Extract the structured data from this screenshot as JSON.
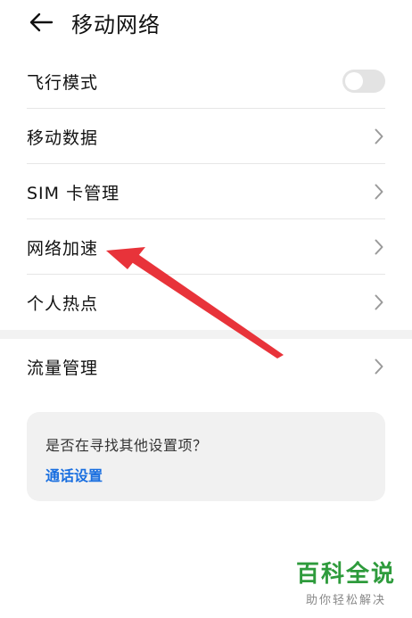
{
  "header": {
    "title": "移动网络",
    "back_icon": "arrow-left-icon"
  },
  "settings": [
    {
      "label": "飞行模式",
      "control": "toggle",
      "toggle_on": false
    },
    {
      "label": "移动数据",
      "control": "chevron"
    },
    {
      "label": "SIM 卡管理",
      "control": "chevron"
    },
    {
      "label": "网络加速",
      "control": "chevron"
    },
    {
      "label": "个人热点",
      "control": "chevron"
    }
  ],
  "settings2": [
    {
      "label": "流量管理",
      "control": "chevron"
    }
  ],
  "suggestion_card": {
    "question": "是否在寻找其他设置项？",
    "link": "通话设置"
  },
  "watermark": {
    "main": "百科全说",
    "sub": "助你轻松解决"
  },
  "colors": {
    "link": "#1a6fe0",
    "annotation_arrow": "#e8333a",
    "watermark": "#2e9b3c"
  }
}
